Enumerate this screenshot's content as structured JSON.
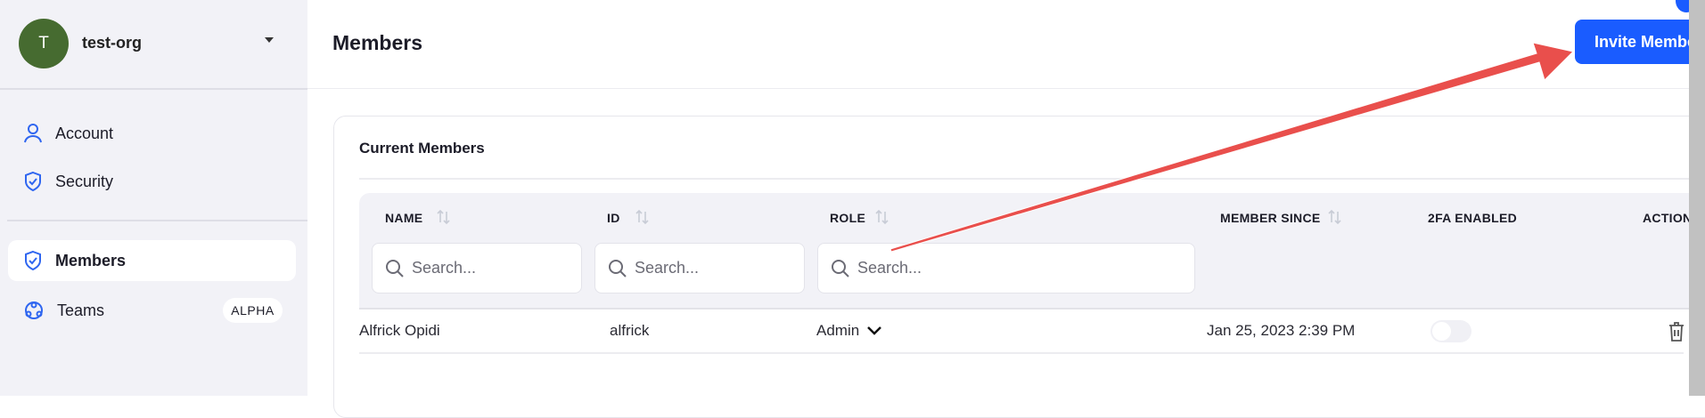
{
  "sidebar": {
    "org_initial": "T",
    "org_name": "test-org",
    "items": [
      {
        "label": "Account",
        "icon": "user-icon"
      },
      {
        "label": "Security",
        "icon": "shield-check-icon"
      },
      {
        "label": "Members",
        "icon": "shield-check-icon",
        "active": true
      },
      {
        "label": "Teams",
        "icon": "teams-icon",
        "badge": "ALPHA"
      }
    ]
  },
  "header": {
    "title": "Members",
    "invite_label": "Invite Members"
  },
  "card": {
    "title": "Current Members",
    "columns": [
      "NAME",
      "ID",
      "ROLE",
      "MEMBER SINCE",
      "2FA ENABLED",
      "ACTIONS"
    ],
    "search_placeholder": "Search...",
    "rows": [
      {
        "name": "Alfrick Opidi",
        "id": "alfrick",
        "role": "Admin",
        "member_since": "Jan 25, 2023 2:39 PM",
        "twofa_enabled": false
      }
    ]
  },
  "colors": {
    "accent": "#1a5cff",
    "avatar": "#466b30",
    "annotation_arrow": "#e94f4c"
  }
}
